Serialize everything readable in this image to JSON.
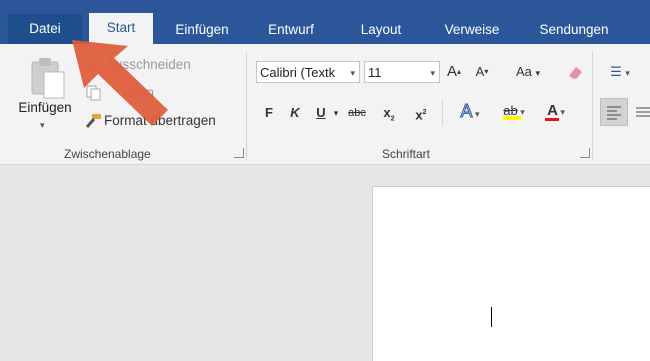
{
  "tabs": [
    {
      "id": "file",
      "label": "Datei"
    },
    {
      "id": "start",
      "label": "Start"
    },
    {
      "id": "insert",
      "label": "Einfügen"
    },
    {
      "id": "design",
      "label": "Entwurf"
    },
    {
      "id": "layout",
      "label": "Layout"
    },
    {
      "id": "references",
      "label": "Verweise"
    },
    {
      "id": "mailings",
      "label": "Sendungen"
    }
  ],
  "clipboard": {
    "paste_label": "Einfügen",
    "cut_label": "Ausschneiden",
    "copy_label": "Kopieren",
    "copy_visible": "ieren",
    "format_painter_label": "Format übertragen",
    "group_label": "Zwischenablage"
  },
  "font": {
    "font_name": "Calibri (Textk",
    "font_size": "11",
    "group_label": "Schriftart",
    "bold": "F",
    "italic": "K",
    "underline": "U",
    "strike": "abc",
    "subscript": "x",
    "superscript": "x",
    "grow": "A",
    "shrink": "A",
    "case": "Aa",
    "effects": "A",
    "highlight": "ab",
    "color": "A"
  },
  "colors": {
    "accent": "#2b579a",
    "file_tab": "#1e4e8c",
    "highlight": "#ffff00",
    "font_color": "#e81123",
    "callout_arrow": "#e05a3a"
  }
}
